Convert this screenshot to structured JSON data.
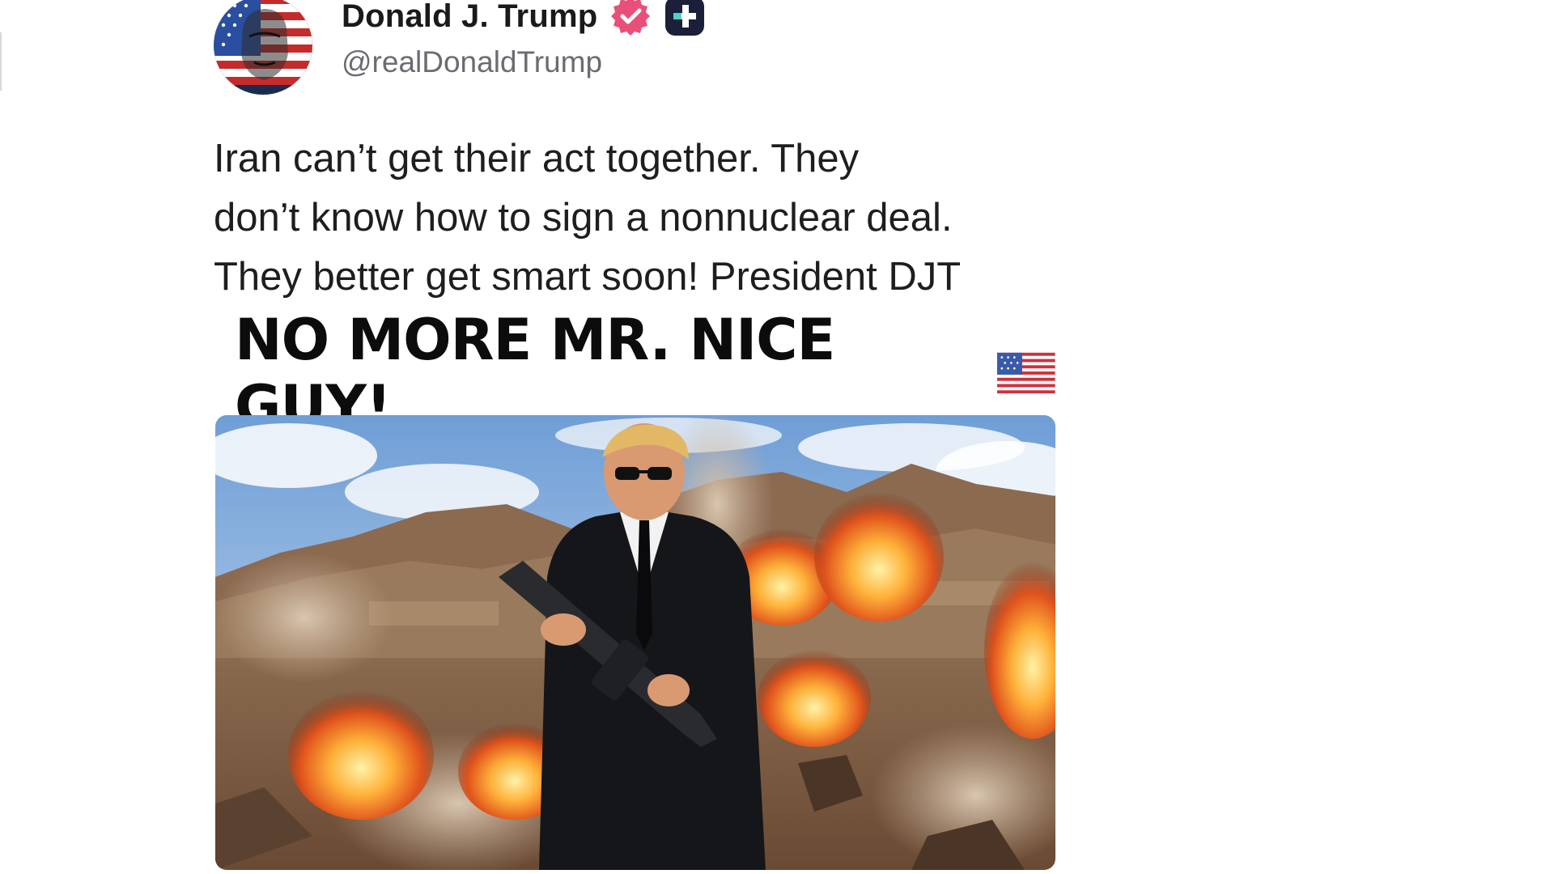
{
  "post": {
    "author": {
      "display_name": "Donald J. Trump",
      "handle": "@realDonaldTrump",
      "avatar_icon": "avatar-flag-portrait",
      "verified_icon": "verified-badge-icon",
      "verified_color": "#e8507a",
      "badge_icon": "plus-badge-icon"
    },
    "text": "Iran can’t get their act together. They\ndon’t know how to sign a nonnuclear deal.\nThey better get smart soon! President DJT",
    "image": {
      "caption": "NO MORE MR. NICE GUY!",
      "caption_emoji_icon": "us-flag-icon"
    }
  }
}
